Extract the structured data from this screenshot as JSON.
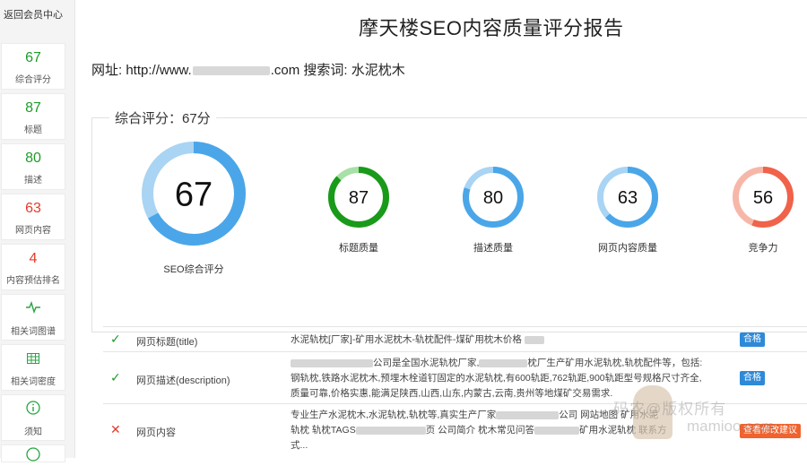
{
  "sidebar": {
    "back_label": "返回会员中心",
    "items": [
      {
        "value": "67",
        "label": "综合评分",
        "color": "green"
      },
      {
        "value": "87",
        "label": "标题",
        "color": "green"
      },
      {
        "value": "80",
        "label": "描述",
        "color": "green"
      },
      {
        "value": "63",
        "label": "网页内容",
        "color": "red"
      },
      {
        "value": "4",
        "label": "内容预估排名",
        "color": "red"
      },
      {
        "icon": "pulse-icon",
        "label": "相关词图谱"
      },
      {
        "icon": "grid-icon",
        "label": "相关词密度"
      },
      {
        "icon": "info-icon",
        "label": "须知"
      }
    ]
  },
  "header": {
    "title": "摩天楼SEO内容质量评分报告",
    "site_prefix": "网址: http://www.",
    "site_suffix": ".com",
    "keyword_label": "搜索词:",
    "keyword": "水泥枕木"
  },
  "overall": {
    "legend": "综合评分：67分"
  },
  "gauges": [
    {
      "value": 67,
      "text": "67",
      "label": "SEO综合评分",
      "color": "#4aa6e8",
      "track": "#a9d4f4"
    },
    {
      "value": 87,
      "text": "87",
      "label": "标题质量",
      "color": "#1a9a1a",
      "track": "#a8e0a8"
    },
    {
      "value": 80,
      "text": "80",
      "label": "描述质量",
      "color": "#4aa6e8",
      "track": "#a9d4f4"
    },
    {
      "value": 63,
      "text": "63",
      "label": "网页内容质量",
      "color": "#4aa6e8",
      "track": "#a9d4f4"
    },
    {
      "value": 56,
      "text": "56",
      "label": "竞争力",
      "color": "#f0624a",
      "track": "#f7b7a8"
    }
  ],
  "rows": [
    {
      "status": "pass",
      "name": "网页标题(title)",
      "content": "水泥轨枕[厂家]-矿用水泥枕木-轨枕配件-煤矿用枕木价格",
      "badge": "合格"
    },
    {
      "status": "pass",
      "name": "网页描述(description)",
      "content_a": "公司是全国水泥轨枕厂家,",
      "content_b": "枕厂生产矿用水泥轨枕,轨枕配件等，包括:",
      "content_c": "钢轨枕,铁路水泥枕木,预埋木栓道钉固定的水泥轨枕,有600轨距,762轨距,900轨距型号规格尺寸齐全,",
      "content_d": "质量可靠,价格实惠,能满足陕西,山西,山东,内蒙古,云南,贵州等地煤矿交易需求.",
      "badge": "合格"
    },
    {
      "status": "fail",
      "name": "网页内容",
      "content_a": "专业生产水泥枕木,水泥轨枕,轨枕等,真实生产厂家",
      "content_b": "公司 网站地图 矿用水泥",
      "content_c": "轨枕 轨枕TAGS",
      "content_d": "页 公司简介 枕木常见问答",
      "content_e": "矿用水泥轨枕 联系方",
      "content_f": "式...",
      "badge": "查看修改建议"
    }
  ],
  "watermark": {
    "line1": "码农@版权所有",
    "line2": "mamioo.com"
  }
}
